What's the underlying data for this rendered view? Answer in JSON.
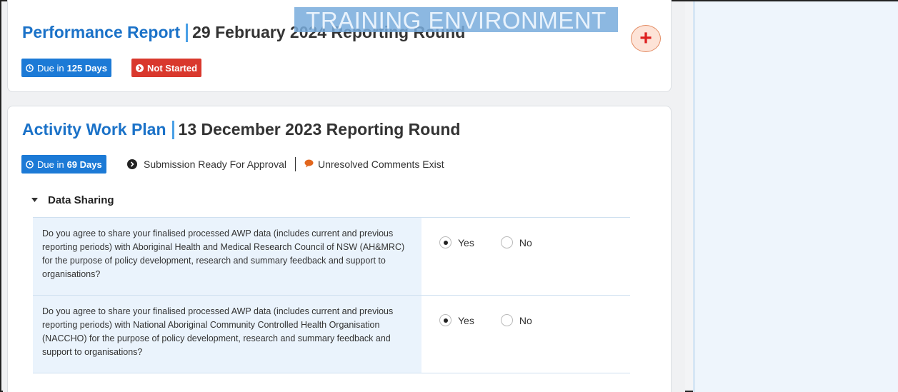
{
  "watermark": "TRAINING ENVIRONMENT",
  "cards": [
    {
      "title": "Performance Report",
      "round": "29 February 2024 Reporting Round",
      "due_prefix": "Due in",
      "due_value": "125 Days",
      "status": "Not Started",
      "add_button": "+"
    },
    {
      "title": "Activity Work Plan",
      "round": "13 December 2023 Reporting Round",
      "due_prefix": "Due in",
      "due_value": "69 Days",
      "status": "Submission Ready For Approval",
      "comments": "Unresolved Comments Exist",
      "section": {
        "title": "Data Sharing",
        "questions": [
          {
            "text": "Do you agree to share your finalised processed AWP data (includes current and previous reporting periods) with Aboriginal Health and Medical Research Council of NSW (AH&MRC) for the purpose of policy development, research and summary feedback and support to organisations?",
            "options": [
              "Yes",
              "No"
            ],
            "selected": "Yes"
          },
          {
            "text": "Do you agree to share your finalised processed AWP data (includes current and previous reporting periods) with National Aboriginal Community Controlled Health Organisation (NACCHO) for the purpose of policy development, research and summary feedback and support to organisations?",
            "options": [
              "Yes",
              "No"
            ],
            "selected": "Yes"
          }
        ]
      }
    }
  ],
  "icons": {
    "clock": "clock-icon",
    "arrow": "arrow-circle-icon",
    "comment": "comment-icon",
    "caret": "caret-down-icon"
  },
  "colors": {
    "primary": "#1c7ad6",
    "danger": "#d9382d",
    "title_blue": "#1b72c8",
    "panel": "#eef5fc"
  }
}
